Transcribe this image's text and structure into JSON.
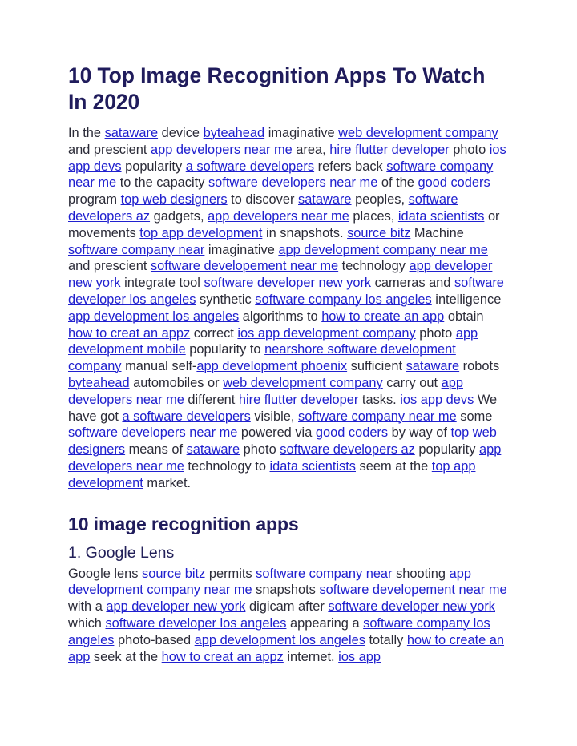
{
  "document": {
    "title": "10 Top Image Recognition Apps To Watch In 2020",
    "colors": {
      "heading": "#201c5c",
      "subheading": "#23215a",
      "body_text": "#2b2b38",
      "link": "#2020cf",
      "background": "#ffffff"
    },
    "sections": [
      {
        "id": "intro",
        "type": "paragraph",
        "runs": [
          {
            "t": "text",
            "v": "In the "
          },
          {
            "t": "link",
            "v": "sataware"
          },
          {
            "t": "text",
            "v": " device "
          },
          {
            "t": "link",
            "v": "byteahead"
          },
          {
            "t": "text",
            "v": " imaginative "
          },
          {
            "t": "link",
            "v": "web development company"
          },
          {
            "t": "text",
            "v": " and prescient "
          },
          {
            "t": "link",
            "v": "app developers near me"
          },
          {
            "t": "text",
            "v": " area, "
          },
          {
            "t": "link",
            "v": "hire flutter developer"
          },
          {
            "t": "text",
            "v": " photo "
          },
          {
            "t": "link",
            "v": "ios app devs"
          },
          {
            "t": "text",
            "v": " popularity "
          },
          {
            "t": "link",
            "v": "a software developers"
          },
          {
            "t": "text",
            "v": " refers back "
          },
          {
            "t": "link",
            "v": "software company near me"
          },
          {
            "t": "text",
            "v": " to the capacity "
          },
          {
            "t": "link",
            "v": "software developers near me"
          },
          {
            "t": "text",
            "v": " of the "
          },
          {
            "t": "link",
            "v": "good coders"
          },
          {
            "t": "text",
            "v": " program "
          },
          {
            "t": "link",
            "v": "top web designers"
          },
          {
            "t": "text",
            "v": " to discover "
          },
          {
            "t": "link",
            "v": "sataware"
          },
          {
            "t": "text",
            "v": " peoples, "
          },
          {
            "t": "link",
            "v": "software developers az"
          },
          {
            "t": "text",
            "v": " gadgets, "
          },
          {
            "t": "link",
            "v": "app developers near me"
          },
          {
            "t": "text",
            "v": " places, "
          },
          {
            "t": "link",
            "v": "idata scientists"
          },
          {
            "t": "text",
            "v": " or movements "
          },
          {
            "t": "link",
            "v": "top app development"
          },
          {
            "t": "text",
            "v": " in snapshots. "
          },
          {
            "t": "link",
            "v": "source bitz"
          },
          {
            "t": "text",
            "v": " Machine "
          },
          {
            "t": "link",
            "v": "software company near"
          },
          {
            "t": "text",
            "v": " imaginative "
          },
          {
            "t": "link",
            "v": "app development company near me"
          },
          {
            "t": "text",
            "v": " and prescient "
          },
          {
            "t": "link",
            "v": "software developement near me"
          },
          {
            "t": "text",
            "v": " technology "
          },
          {
            "t": "link",
            "v": "app developer new york"
          },
          {
            "t": "text",
            "v": " integrate tool "
          },
          {
            "t": "link",
            "v": "software developer new york"
          },
          {
            "t": "text",
            "v": " cameras and "
          },
          {
            "t": "link",
            "v": "software developer los angeles"
          },
          {
            "t": "text",
            "v": " synthetic "
          },
          {
            "t": "link",
            "v": "software company los angeles"
          },
          {
            "t": "text",
            "v": " intelligence "
          },
          {
            "t": "link",
            "v": "app development los angeles"
          },
          {
            "t": "text",
            "v": " algorithms to "
          },
          {
            "t": "link",
            "v": "how to create an app"
          },
          {
            "t": "text",
            "v": " obtain "
          },
          {
            "t": "link",
            "v": "how to creat an appz"
          },
          {
            "t": "text",
            "v": " correct "
          },
          {
            "t": "link",
            "v": "ios app development company"
          },
          {
            "t": "text",
            "v": " photo "
          },
          {
            "t": "link",
            "v": "app development mobile"
          },
          {
            "t": "text",
            "v": " popularity to "
          },
          {
            "t": "link",
            "v": "nearshore software development company"
          },
          {
            "t": "text",
            "v": " manual self-"
          },
          {
            "t": "link",
            "v": "app development phoenix"
          },
          {
            "t": "text",
            "v": " sufficient "
          },
          {
            "t": "link",
            "v": "sataware"
          },
          {
            "t": "text",
            "v": " robots "
          },
          {
            "t": "link",
            "v": "byteahead"
          },
          {
            "t": "text",
            "v": " automobiles or "
          },
          {
            "t": "link",
            "v": "web development company"
          },
          {
            "t": "text",
            "v": " carry out "
          },
          {
            "t": "link",
            "v": "app developers near me"
          },
          {
            "t": "text",
            "v": " different "
          },
          {
            "t": "link",
            "v": "hire flutter developer"
          },
          {
            "t": "text",
            "v": " tasks. "
          },
          {
            "t": "link",
            "v": "ios app devs"
          },
          {
            "t": "text",
            "v": " We have got "
          },
          {
            "t": "link",
            "v": "a software developers"
          },
          {
            "t": "text",
            "v": " visible, "
          },
          {
            "t": "link",
            "v": "software company near me"
          },
          {
            "t": "text",
            "v": " some "
          },
          {
            "t": "link",
            "v": "software developers near me"
          },
          {
            "t": "text",
            "v": " powered via "
          },
          {
            "t": "link",
            "v": "good coders"
          },
          {
            "t": "text",
            "v": " by way of "
          },
          {
            "t": "link",
            "v": "top web designers"
          },
          {
            "t": "text",
            "v": " means of "
          },
          {
            "t": "link",
            "v": "sataware"
          },
          {
            "t": "text",
            "v": " photo "
          },
          {
            "t": "link",
            "v": "software developers az"
          },
          {
            "t": "text",
            "v": " popularity "
          },
          {
            "t": "link",
            "v": "app developers near me"
          },
          {
            "t": "text",
            "v": " technology to "
          },
          {
            "t": "link",
            "v": "idata scientists"
          },
          {
            "t": "text",
            "v": " seem at the "
          },
          {
            "t": "link",
            "v": "top app development"
          },
          {
            "t": "text",
            "v": " market."
          }
        ]
      },
      {
        "id": "apps-heading",
        "type": "heading2",
        "text": "10 image recognition apps"
      },
      {
        "id": "google-lens-heading",
        "type": "heading3",
        "text": "1. Google Lens"
      },
      {
        "id": "google-lens-body",
        "type": "paragraph",
        "runs": [
          {
            "t": "text",
            "v": "Google lens "
          },
          {
            "t": "link",
            "v": "source bitz"
          },
          {
            "t": "text",
            "v": " permits "
          },
          {
            "t": "link",
            "v": "software company near"
          },
          {
            "t": "text",
            "v": " shooting "
          },
          {
            "t": "link",
            "v": "app development company near me"
          },
          {
            "t": "text",
            "v": " snapshots "
          },
          {
            "t": "link",
            "v": "software developement near me"
          },
          {
            "t": "text",
            "v": " with a "
          },
          {
            "t": "link",
            "v": "app developer new york"
          },
          {
            "t": "text",
            "v": " digicam after "
          },
          {
            "t": "link",
            "v": "software developer new york"
          },
          {
            "t": "text",
            "v": " which "
          },
          {
            "t": "link",
            "v": "software developer los angeles"
          },
          {
            "t": "text",
            "v": " appearing a "
          },
          {
            "t": "link",
            "v": "software company los angeles"
          },
          {
            "t": "text",
            "v": " photo-based "
          },
          {
            "t": "link",
            "v": "app development los angeles"
          },
          {
            "t": "text",
            "v": " totally "
          },
          {
            "t": "link",
            "v": "how to create an app"
          },
          {
            "t": "text",
            "v": " seek at the "
          },
          {
            "t": "link",
            "v": "how to creat an appz"
          },
          {
            "t": "text",
            "v": " internet. "
          },
          {
            "t": "link",
            "v": "ios app"
          }
        ]
      }
    ]
  }
}
